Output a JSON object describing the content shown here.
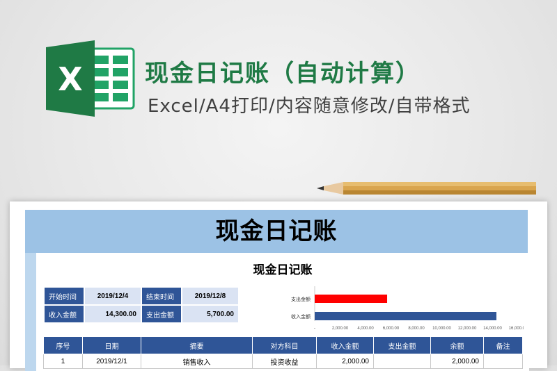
{
  "promo": {
    "title": "现金日记账（自动计算）",
    "subtitle": "Excel/A4打印/内容随意修改/自带格式",
    "logo_letter": "X",
    "logo_color": "#1f7a45"
  },
  "sheet": {
    "header_title": "现金日记账",
    "title": "现金日记账",
    "summary": {
      "start_label": "开始时间",
      "start_value": "2019/12/4",
      "end_label": "结束时间",
      "end_value": "2019/12/8",
      "income_label": "收入金额",
      "income_value": "14,300.00",
      "expense_label": "支出金额",
      "expense_value": "5,700.00"
    },
    "columns": [
      "序号",
      "日期",
      "摘要",
      "对方科目",
      "收入金额",
      "支出金额",
      "余额",
      "备注"
    ],
    "rows": [
      {
        "no": "1",
        "date": "2019/12/1",
        "summary": "销售收入",
        "account": "投资收益",
        "income": "2,000.00",
        "expense": "",
        "balance": "2,000.00",
        "note": ""
      }
    ]
  },
  "chart_data": {
    "type": "bar",
    "orientation": "horizontal",
    "categories": [
      "支出金额",
      "收入金额"
    ],
    "values": [
      5700,
      14300
    ],
    "colors": [
      "#ff0000",
      "#2f5597"
    ],
    "xlim": [
      0,
      16000
    ],
    "xticks": [
      "-",
      "2,000.00",
      "4,000.00",
      "6,000.00",
      "8,000.00",
      "10,000.00",
      "12,000.00",
      "14,000.00",
      "16,000.00"
    ],
    "title": "",
    "xlabel": "",
    "ylabel": "",
    "grid": false,
    "legend": "none"
  }
}
